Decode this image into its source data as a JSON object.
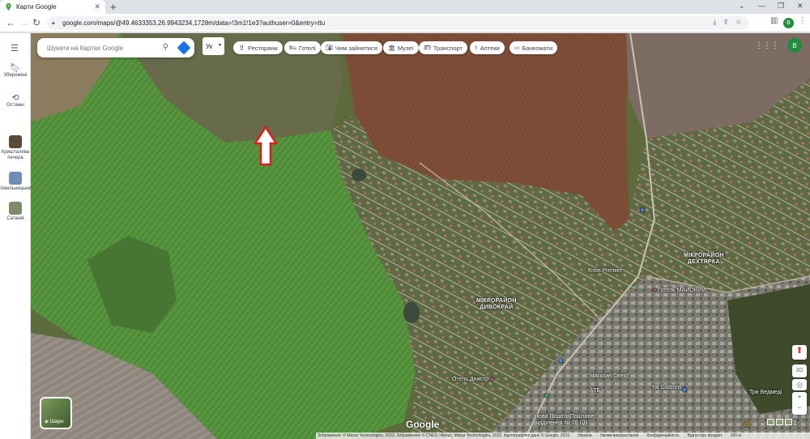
{
  "browser": {
    "tab_title": "Карти Google",
    "url": "google.com/maps/@49.4633353,26.9943234,1728m/data=!3m1!1e3?authuser=0&entry=ttu",
    "profile_initial": "B"
  },
  "search": {
    "placeholder": "Шукати на Картах Google",
    "language": "Ук"
  },
  "sidebar": {
    "items": [
      {
        "label": "Збережені"
      },
      {
        "label": "Останні"
      },
      {
        "label": "Кришталева печера"
      },
      {
        "label": "Хмельницький"
      },
      {
        "label": "Сатанів"
      }
    ]
  },
  "chips": [
    {
      "label": "Ресторани",
      "icon": "fork-knife-icon"
    },
    {
      "label": "Готелі",
      "icon": "bed-icon"
    },
    {
      "label": "Чим зайнятися",
      "icon": "camera-icon"
    },
    {
      "label": "Музеї",
      "icon": "museum-icon"
    },
    {
      "label": "Транспорт",
      "icon": "bus-icon"
    },
    {
      "label": "Аптеки",
      "icon": "pharmacy-icon"
    },
    {
      "label": "Банкомати",
      "icon": "atm-icon"
    }
  ],
  "map": {
    "labels": {
      "dykhtyarka": "МІКРОРАЙОН\nДЕХТЯРКА",
      "dyvokrai": "МІКРОРАЙОН\nДИВОКРАЙ",
      "hotel": "Готель МАЙОВИЙ",
      "kopt": "Кпоп Premier",
      "otel_dnistr": "Отель Днистр",
      "yalgub": "Yal Gibbons",
      "nova_poshta": "Нова Пошта. Поштове\nвідділення № 28 ЦВ",
      "tri_vedmedi": "Три Ведмеді",
      "atb": "АТБ",
      "magazin": "Магазин Свет"
    },
    "layer_label": "Шари",
    "google_logo": "Google",
    "attribution": "Зображення: © Maxar Technologies, 2023, Зображення: © CNES / Airbus, Maxar Technologies, 2023, Картографічні дані: © Google, 2023",
    "footer_links": [
      "Україна",
      "Умови використання",
      "Конфіденційність",
      "Відгук про продукт"
    ],
    "scale": "200 м",
    "arrow_color": "#e8161d"
  }
}
